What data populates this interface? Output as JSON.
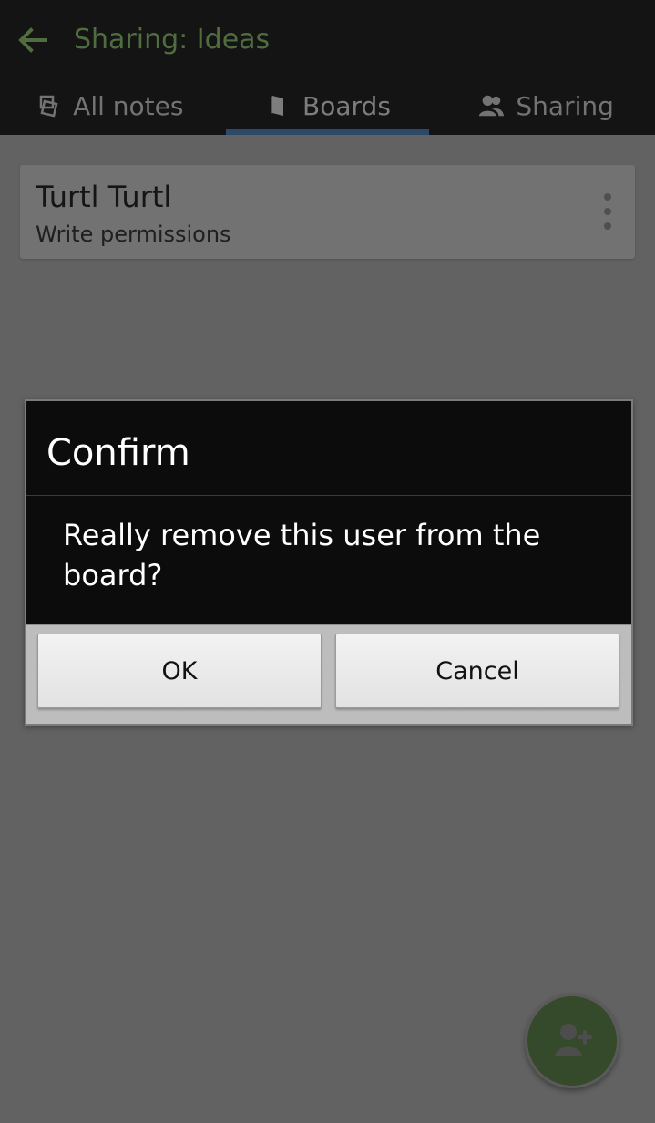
{
  "header": {
    "title": "Sharing: Ideas",
    "back_icon": "arrow-left-icon",
    "colors": {
      "title": "#4f6d3f",
      "background": "#141414"
    }
  },
  "tabs": [
    {
      "label": "All notes",
      "icon": "notes-icon",
      "active": false
    },
    {
      "label": "Boards",
      "icon": "book-icon",
      "active": true
    },
    {
      "label": "Sharing",
      "icon": "users-icon",
      "active": false
    }
  ],
  "shared_user": {
    "name": "Turtl Turtl",
    "permission": "Write permissions",
    "menu_icon": "more-vertical-icon"
  },
  "dialog": {
    "title": "Confirm",
    "message": "Really remove this user from the board?",
    "ok_label": "OK",
    "cancel_label": "Cancel"
  },
  "fab": {
    "icon": "add-user-icon",
    "color": "#344a2b"
  },
  "colors": {
    "dim_background": "#626262",
    "accent_tab_indicator": "#2c4a68"
  }
}
